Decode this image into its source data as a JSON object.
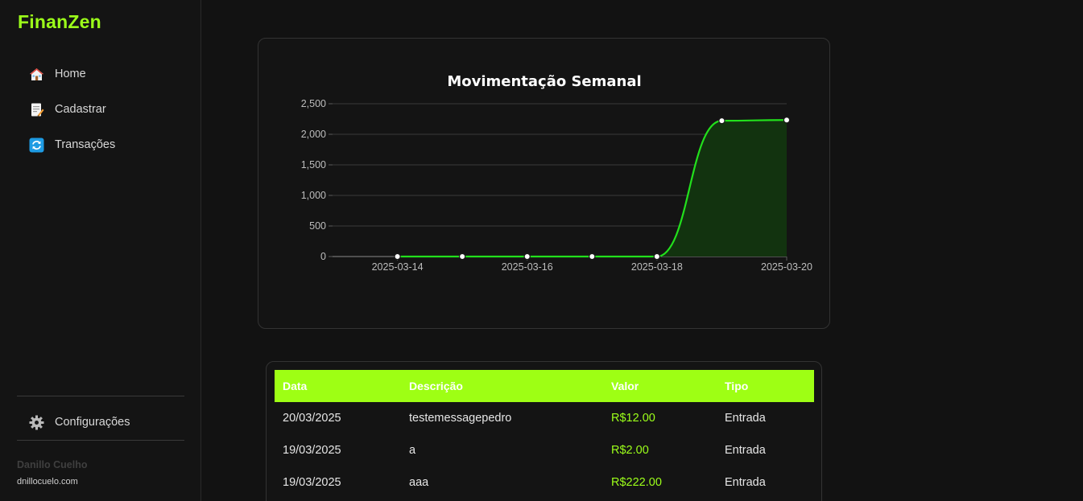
{
  "app": {
    "brand": "FinanZen"
  },
  "sidebar": {
    "items": [
      {
        "label": "Home",
        "icon": "house-icon"
      },
      {
        "label": "Cadastrar",
        "icon": "memo-icon"
      },
      {
        "label": "Transações",
        "icon": "refresh-icon"
      }
    ],
    "settings": {
      "label": "Configurações",
      "icon": "gear-icon"
    },
    "user": {
      "name": "Danillo Cuelho",
      "site": "dnillocuelo.com"
    }
  },
  "colors": {
    "accent": "#9eff14",
    "line": "#22e01c",
    "fill": "#12330f",
    "background": "#121212"
  },
  "chart_data": {
    "type": "line",
    "title": "Movimentação Semanal",
    "x": [
      "2025-03-14",
      "2025-03-15",
      "2025-03-16",
      "2025-03-17",
      "2025-03-18",
      "2025-03-19",
      "2025-03-20"
    ],
    "values": [
      0,
      0,
      0,
      0,
      0,
      2222,
      2234
    ],
    "x_tick_labels": [
      "2025-03-14",
      "2025-03-16",
      "2025-03-18",
      "2025-03-20"
    ],
    "y_tick_labels": [
      "0",
      "500",
      "1,000",
      "1,500",
      "2,000",
      "2,500"
    ],
    "ylim": [
      0,
      2500
    ],
    "xlim": [
      "2025-03-13",
      "2025-03-20"
    ],
    "area_fill": true,
    "grid": true,
    "legend": "none"
  },
  "table": {
    "headers": [
      "Data",
      "Descrição",
      "Valor",
      "Tipo"
    ],
    "rows": [
      {
        "data": "20/03/2025",
        "descricao": "testemessagepedro",
        "valor": "R$12.00",
        "tipo": "Entrada"
      },
      {
        "data": "19/03/2025",
        "descricao": "a",
        "valor": "R$2.00",
        "tipo": "Entrada"
      },
      {
        "data": "19/03/2025",
        "descricao": "aaa",
        "valor": "R$222.00",
        "tipo": "Entrada"
      }
    ]
  }
}
